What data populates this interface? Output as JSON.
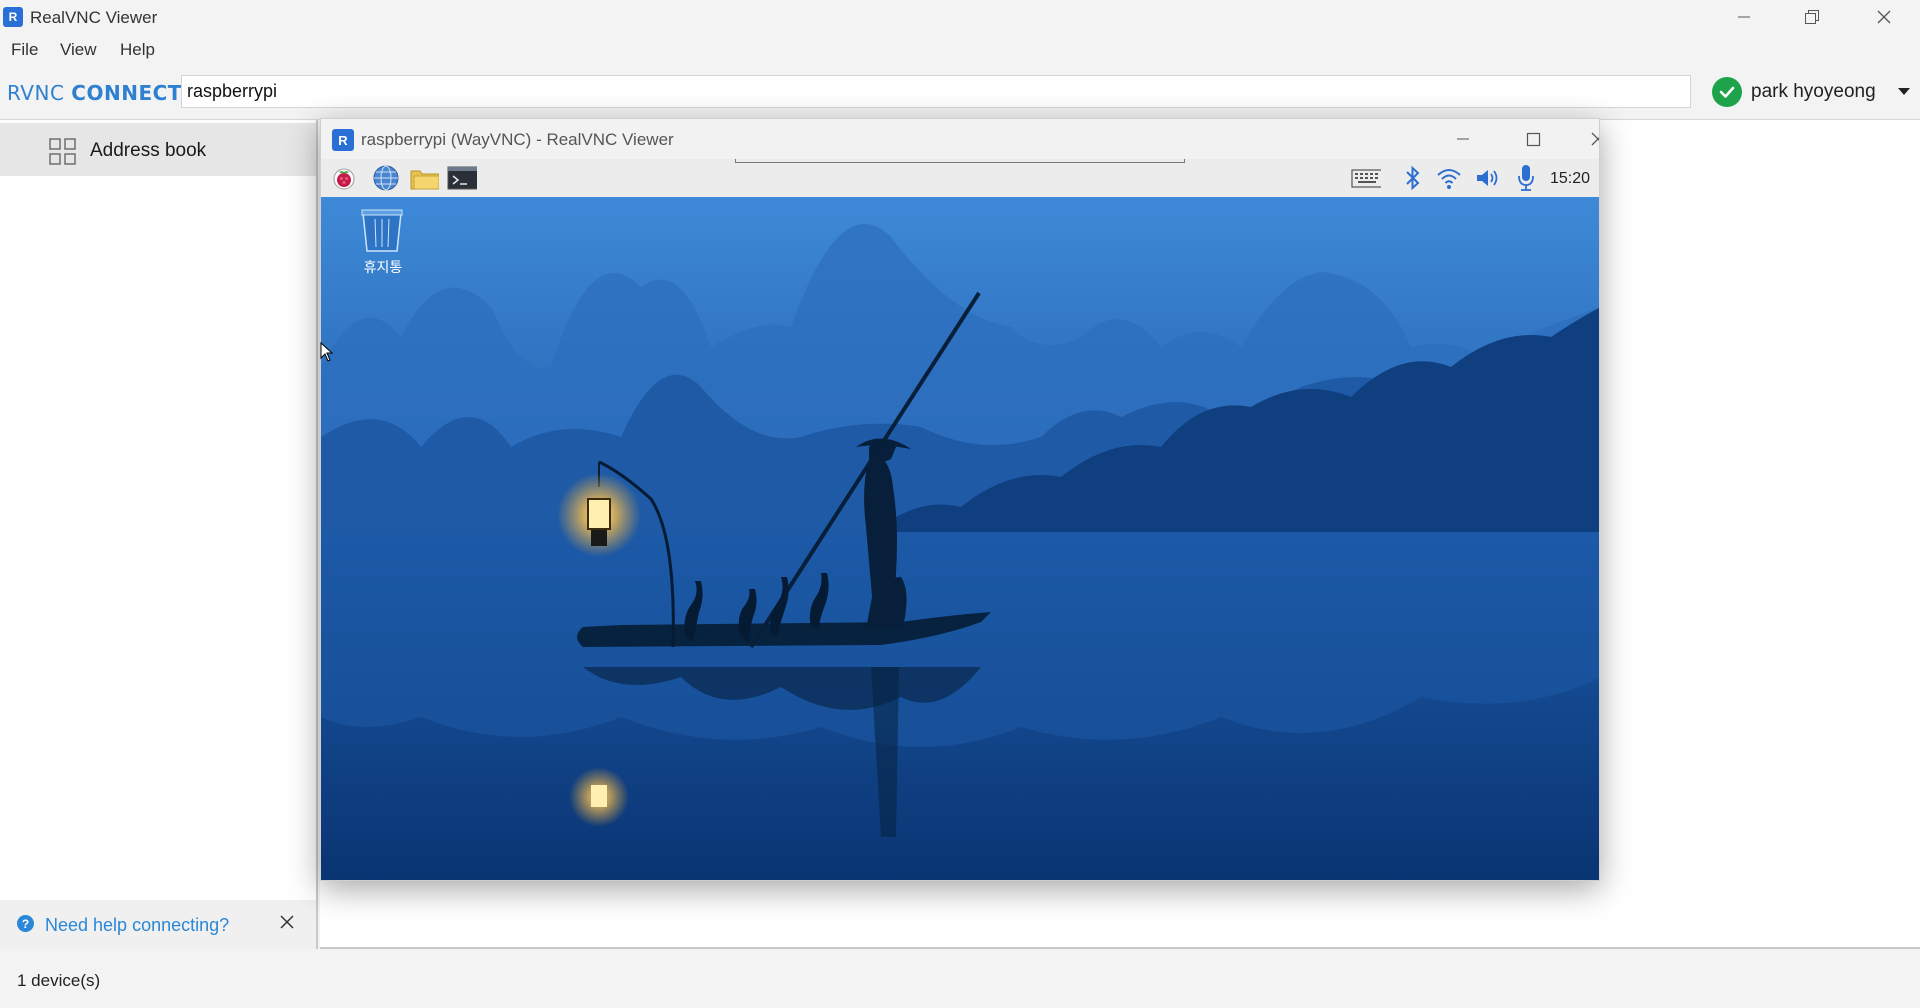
{
  "app": {
    "title": "RealVNC Viewer",
    "logo_glyph": "R"
  },
  "menu": {
    "file": "File",
    "view": "View",
    "help": "Help"
  },
  "toolbar": {
    "brand_light": "RVNC",
    "brand_bold": "CONNECT",
    "address_value": "raspberrypi",
    "user_name": "park hyoyeong",
    "user_status_color": "#1ea34a"
  },
  "sidebar": {
    "address_book_label": "Address book",
    "help_link": "Need help connecting?",
    "help_icon_glyph": "?"
  },
  "status": {
    "device_count": "1 device(s)"
  },
  "vnc_window": {
    "title": "raspberrypi (WayVNC) - RealVNC Viewer",
    "logo_glyph": "R",
    "clock": "15:20",
    "trash_label": "휴지통"
  },
  "colors": {
    "accent": "#2b87d7",
    "brand": "#2f80d1",
    "success": "#1ea34a"
  }
}
